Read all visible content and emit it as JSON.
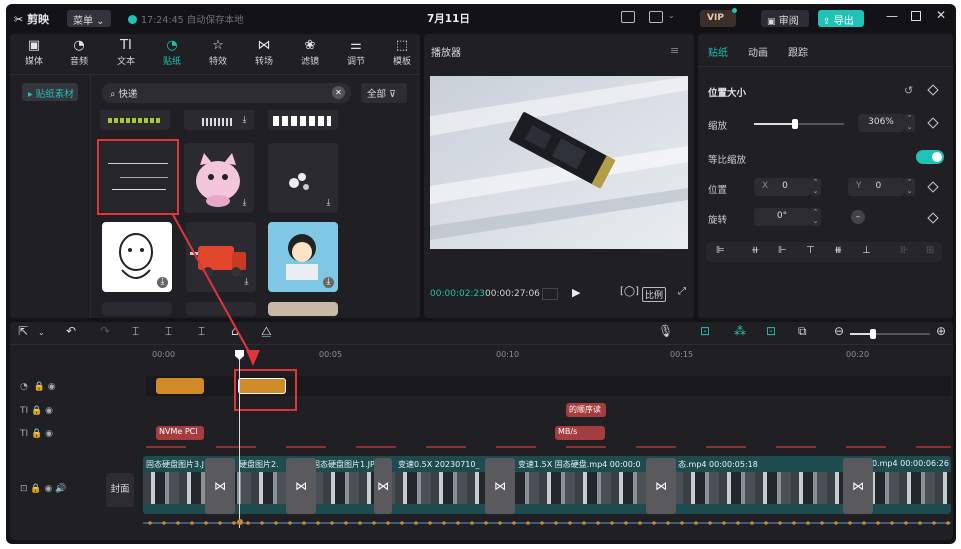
{
  "app": {
    "logo": "剪映",
    "menu": "菜单",
    "save_status": "17:24:45 自动保存本地",
    "project_title": "7月11日",
    "vip": "VIP",
    "review": "审阅",
    "export": "导出"
  },
  "toolbar": {
    "items": [
      {
        "label": "媒体",
        "icon": "media-icon"
      },
      {
        "label": "音频",
        "icon": "audio-icon"
      },
      {
        "label": "文本",
        "icon": "text-icon"
      },
      {
        "label": "贴纸",
        "icon": "sticker-icon",
        "active": true
      },
      {
        "label": "特效",
        "icon": "effects-icon"
      },
      {
        "label": "转场",
        "icon": "transition-icon"
      },
      {
        "label": "滤镜",
        "icon": "filter-icon"
      },
      {
        "label": "调节",
        "icon": "adjust-icon"
      },
      {
        "label": "模板",
        "icon": "template-icon"
      }
    ]
  },
  "library": {
    "side_item": "▸ 贴纸素材",
    "search_value": "快递",
    "filter_label": "全部"
  },
  "player": {
    "title": "播放器",
    "current_time": "00:00:02:23",
    "total_time": "00:00:27:06",
    "ratio": "比例"
  },
  "inspector": {
    "tabs": [
      "贴纸",
      "动画",
      "跟踪"
    ],
    "section": "位置大小",
    "scale_label": "缩放",
    "scale_value": "306%",
    "scale_fraction": 0.45,
    "uniform_label": "等比缩放",
    "position_label": "位置",
    "x_label": "X",
    "x_value": "0",
    "y_label": "Y",
    "y_value": "0",
    "rotate_label": "旋转",
    "rotate_value": "0°"
  },
  "timeline": {
    "ruler": [
      "00:00",
      "00:05",
      "00:10",
      "00:15",
      "00:20"
    ],
    "cover_label": "封面",
    "text_clips": [
      "的顺序读",
      "NVMe PCI",
      "MB/s"
    ],
    "video_labels": [
      "固态硬盘图片3.J",
      "硬盘图片2.",
      "固态硬盘图片1.JPG",
      "变速0.5X 20230710_",
      "变速1.5X 固态硬盘.mp4 00:00:0",
      "态.mp4 00:00:05:18",
      "0.mp4 00:00:06:26"
    ]
  }
}
